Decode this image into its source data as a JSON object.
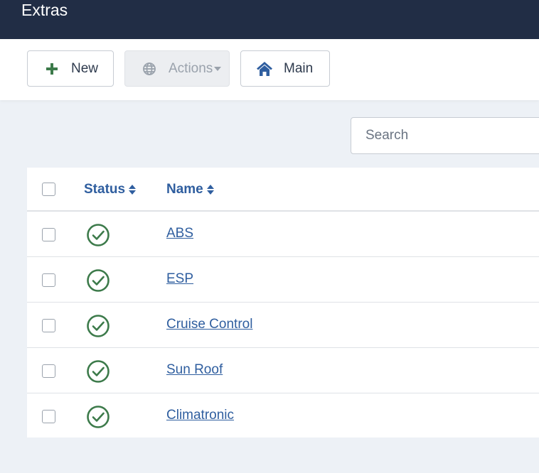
{
  "header": {
    "title": "Extras"
  },
  "toolbar": {
    "new_label": "New",
    "actions_label": "Actions",
    "main_label": "Main"
  },
  "search": {
    "placeholder": "Search",
    "value": ""
  },
  "table": {
    "columns": {
      "status": "Status",
      "name": "Name"
    },
    "rows": [
      {
        "name": "ABS",
        "status": "published"
      },
      {
        "name": "ESP",
        "status": "published"
      },
      {
        "name": "Cruise Control",
        "status": "published"
      },
      {
        "name": "Sun Roof",
        "status": "published"
      },
      {
        "name": "Climatronic",
        "status": "published"
      }
    ]
  },
  "colors": {
    "header_bg": "#212d45",
    "link": "#2f5e9f",
    "status_ok": "#3c7a4a",
    "page_bg": "#edf1f6"
  },
  "icons": {
    "new": "plus-icon",
    "actions": "globe-icon",
    "main": "home-icon",
    "sort": "sort-icon",
    "status": "check-circle-icon"
  }
}
